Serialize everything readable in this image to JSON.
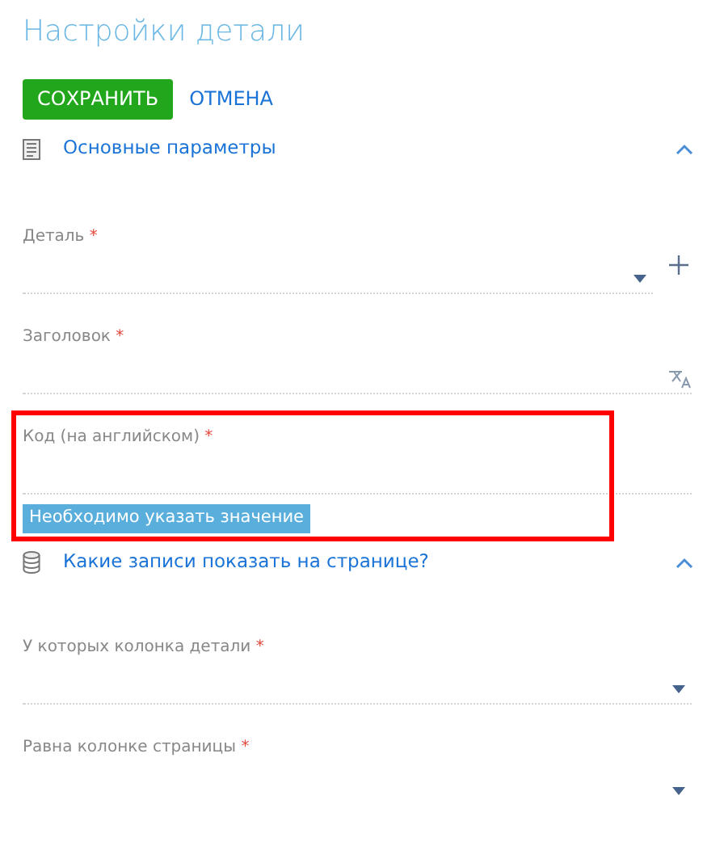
{
  "title": "Настройки детали",
  "buttons": [
    {
      "label": "СОХРАНИТЬ",
      "kind": "primary"
    },
    {
      "label": "ОТМЕНА",
      "kind": "link"
    }
  ],
  "sections": [
    {
      "title": "Основные параметры",
      "expanded": true,
      "fields": [
        {
          "label": "Деталь",
          "required_mark": "*",
          "kind": "lookup",
          "add_button": true,
          "underlined": true,
          "highlighted": false
        },
        {
          "label": "Заголовок",
          "required_mark": "*",
          "kind": "localizable",
          "underlined": true,
          "highlighted": false
        },
        {
          "label": "Код (на английском)",
          "required_mark": "*",
          "kind": "text",
          "underlined": true,
          "highlighted": true,
          "error": "Необходимо указать значение"
        }
      ]
    },
    {
      "title": "Какие записи показать на странице?",
      "expanded": true,
      "fields": [
        {
          "label": "У которых колонка детали",
          "required_mark": "*",
          "kind": "lookup",
          "add_button": false,
          "underlined": true,
          "highlighted": false
        },
        {
          "label": "Равна колонке страницы",
          "required_mark": "*",
          "kind": "lookup",
          "add_button": false,
          "underlined": false,
          "highlighted": false
        }
      ]
    }
  ]
}
